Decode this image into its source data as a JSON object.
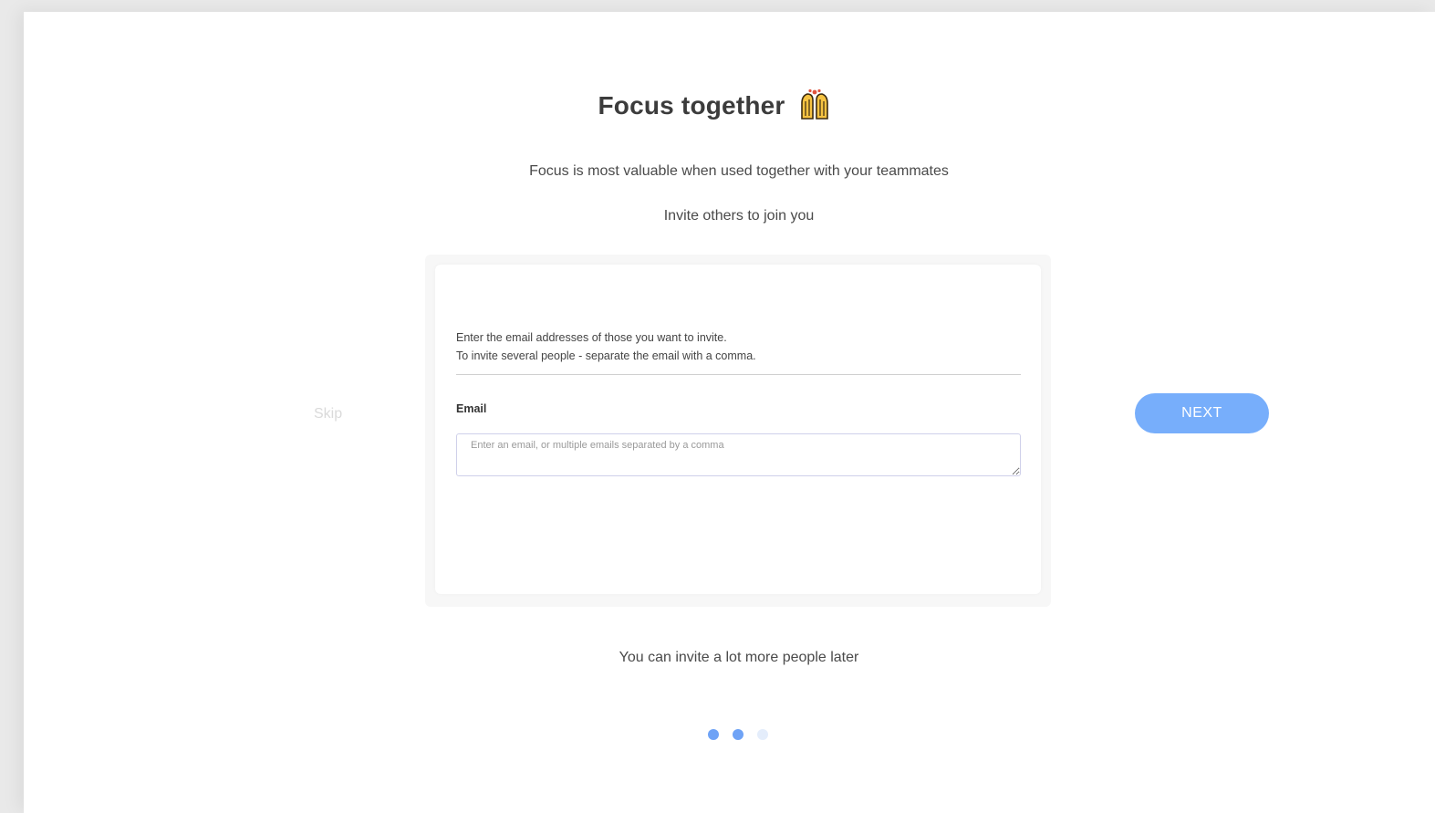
{
  "header": {
    "title": "Focus together",
    "title_icon": "raising-hands-icon",
    "subtitle": "Focus is most valuable when used together with your teammates",
    "invite_prompt": "Invite others to join you"
  },
  "card": {
    "help_line1": "Enter the email addresses of those you want to invite.",
    "help_line2": "To invite several people - separate the email with a comma.",
    "email_label": "Email",
    "email_placeholder": "Enter an email, or multiple emails separated by a comma",
    "email_value": ""
  },
  "actions": {
    "skip_label": "Skip",
    "next_label": "NEXT"
  },
  "footer": {
    "note": "You can invite a lot more people later"
  },
  "pagination": {
    "total_steps": 3,
    "active_steps": 2
  },
  "colors": {
    "accent": "#77aefb",
    "dot_active": "#6fa3f6",
    "dot_inactive": "#e4edfb",
    "text": "#4a4a4a"
  }
}
